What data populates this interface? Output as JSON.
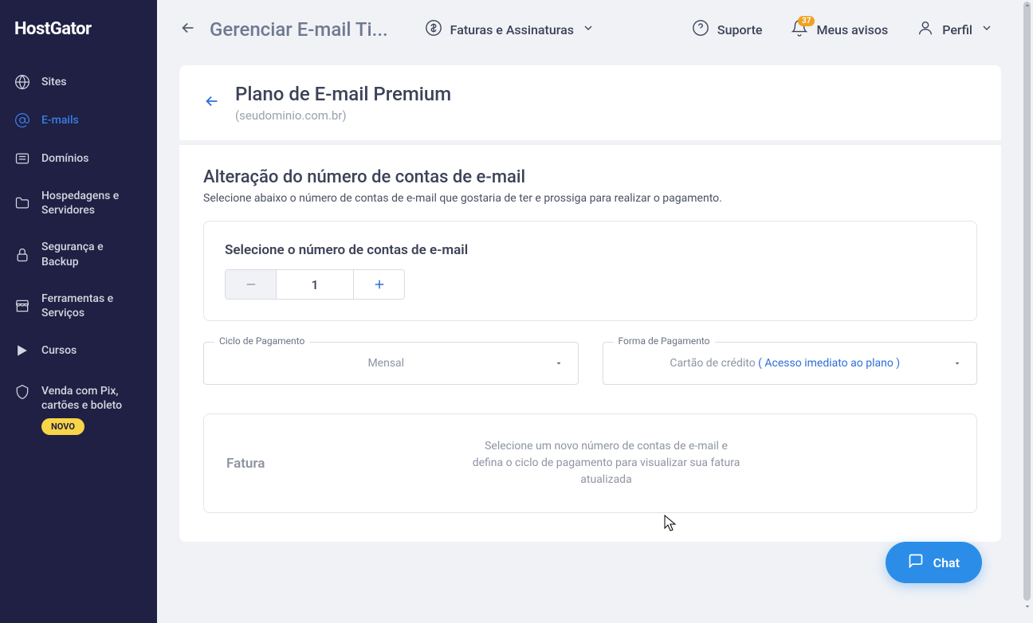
{
  "logo": "HostGator",
  "sidebar": {
    "items": [
      {
        "label": "Sites",
        "icon": "globe"
      },
      {
        "label": "E-mails",
        "icon": "at",
        "active": true
      },
      {
        "label": "Domínios",
        "icon": "list"
      },
      {
        "label": "Hospedagens e Servidores",
        "icon": "folder"
      },
      {
        "label": "Segurança e Backup",
        "icon": "lock"
      },
      {
        "label": "Ferramentas e Serviços",
        "icon": "store"
      },
      {
        "label": "Cursos",
        "icon": "play"
      },
      {
        "label": "Venda com Pix, cartões e boleto",
        "icon": "shield",
        "badge": "NOVO"
      }
    ]
  },
  "topbar": {
    "title": "Gerenciar E-mail Ti...",
    "items": {
      "invoices": "Faturas e Assinaturas",
      "support": "Suporte",
      "notifications": "Meus avisos",
      "notif_count": "37",
      "profile": "Perfil"
    }
  },
  "header": {
    "title": "Plano de E-mail Premium",
    "domain": "(seudominio.com.br)"
  },
  "content": {
    "section_title": "Alteração do número de contas de e-mail",
    "section_desc": "Selecione abaixo o número de contas de e-mail que gostaria de ter e prossiga para realizar o pagamento.",
    "accounts_label": "Selecione o número de contas de e-mail",
    "accounts_value": "1",
    "cycle": {
      "label": "Ciclo de Pagamento",
      "value": "Mensal"
    },
    "payment": {
      "label": "Forma de Pagamento",
      "value_prefix": "Cartão de crédito ",
      "value_blue": "( Acesso imediato ao plano )"
    },
    "invoice": {
      "title": "Fatura",
      "desc": "Selecione um novo número de contas de e-mail e defina o ciclo de pagamento para visualizar sua fatura atualizada"
    }
  },
  "chat": "Chat"
}
